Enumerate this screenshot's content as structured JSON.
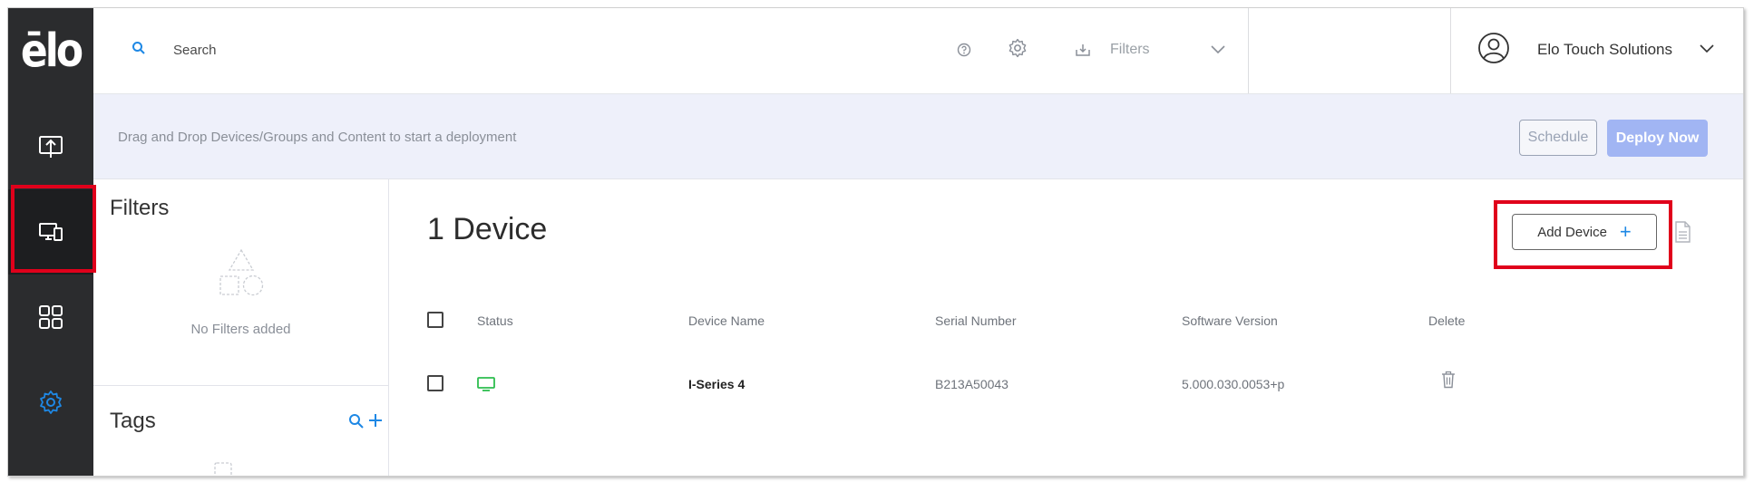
{
  "app": {
    "logo_text": "ēlo"
  },
  "colors": {
    "accent": "#1e88e5",
    "annotation_red": "#e0001b",
    "rail_bg": "#2b2c2e",
    "online_green": "#2dbd4e",
    "deploy_button": "#a1b5f3"
  },
  "sidebar": {
    "items": [
      {
        "name": "deploy",
        "icon": "upload-screen-icon"
      },
      {
        "name": "devices",
        "icon": "devices-icon",
        "active": true
      },
      {
        "name": "apps",
        "icon": "grid-icon"
      },
      {
        "name": "settings",
        "icon": "gear-icon"
      }
    ]
  },
  "topbar": {
    "search_placeholder": "Search",
    "filters_label": "Filters",
    "user_name": "Elo Touch Solutions"
  },
  "deploy_bar": {
    "instructions": "Drag and Drop Devices/Groups and Content to start a deployment",
    "schedule_label": "Schedule",
    "deploy_now_label": "Deploy Now"
  },
  "filters_panel": {
    "title": "Filters",
    "empty_text": "No Filters added"
  },
  "tags_panel": {
    "title": "Tags"
  },
  "devices": {
    "count_title": "1 Device",
    "add_device_label": "Add Device",
    "columns": [
      "Status",
      "Device Name",
      "Serial Number",
      "Software Version",
      "Delete"
    ],
    "rows": [
      {
        "status": "online",
        "device_name": "I-Series 4",
        "serial_number": "B213A50043",
        "software_version": "5.000.030.0053+p"
      }
    ]
  }
}
